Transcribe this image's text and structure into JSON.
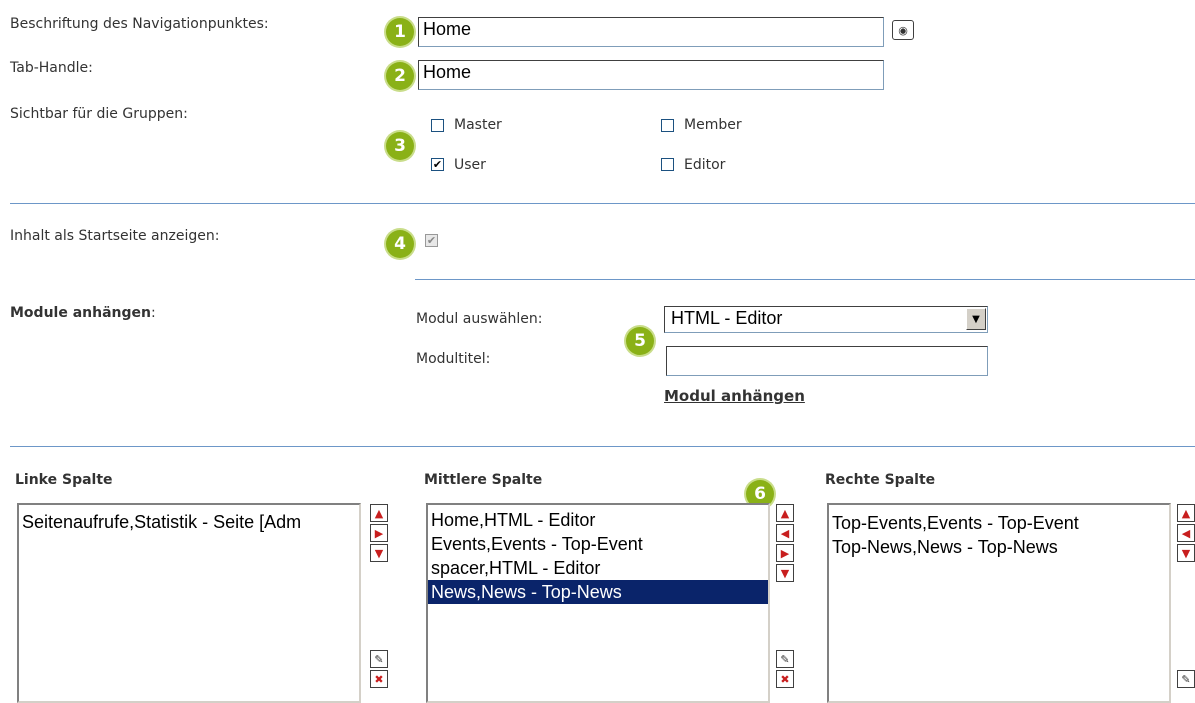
{
  "form": {
    "nav_label": "Beschriftung des Navigationpunktes:",
    "nav_value": "Home",
    "tab_label": "Tab-Handle:",
    "tab_value": "Home",
    "groups_label": "Sichtbar für die Gruppen:",
    "groups": [
      {
        "label": "Master",
        "checked": false
      },
      {
        "label": "Member",
        "checked": false
      },
      {
        "label": "User",
        "checked": true
      },
      {
        "label": "Editor",
        "checked": false
      }
    ],
    "startpage_label": "Inhalt als Startseite anzeigen:",
    "startpage_checked": true
  },
  "modules": {
    "section_label": "Module anhängen",
    "section_colon": ":",
    "select_label": "Modul auswählen:",
    "select_value": "HTML - Editor",
    "title_label": "Modultitel:",
    "title_value": "",
    "attach_link": "Modul anhängen"
  },
  "columns": {
    "left": {
      "header": "Linke Spalte",
      "items": [
        "Seitenaufrufe,Statistik - Seite [Adm"
      ]
    },
    "middle": {
      "header": "Mittlere Spalte",
      "items": [
        "Home,HTML - Editor",
        "Events,Events - Top-Event",
        "spacer,HTML - Editor",
        "News,News - Top-News"
      ],
      "selected_index": 3
    },
    "right": {
      "header": "Rechte Spalte",
      "items": [
        "Top-Events,Events - Top-Event",
        "Top-News,News - Top-News"
      ]
    }
  },
  "markers": [
    "1",
    "2",
    "3",
    "4",
    "5",
    "6"
  ],
  "colors": {
    "marker": "#8ab117",
    "separator": "#6d97c8",
    "selection": "#0a246a",
    "icon_red": "#c81e1e"
  },
  "icons": [
    "preview-eye-icon",
    "move-up-icon",
    "move-left-icon",
    "move-right-icon",
    "move-down-icon",
    "edit-pencil-icon",
    "delete-x-icon",
    "dropdown-arrow-icon"
  ]
}
